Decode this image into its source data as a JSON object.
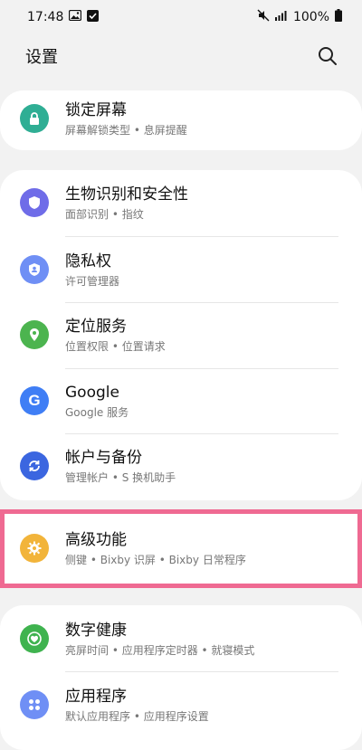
{
  "status_bar": {
    "time": "17:48",
    "battery": "100%"
  },
  "header": {
    "title": "设置"
  },
  "items": [
    {
      "title": "锁定屏幕",
      "subtitle": "屏幕解锁类型 • 息屏提醒",
      "color": "#2fae94"
    },
    {
      "title": "生物识别和安全性",
      "subtitle": "面部识别 • 指纹",
      "color": "#6f6ce8"
    },
    {
      "title": "隐私权",
      "subtitle": "许可管理器",
      "color": "#6f8ff5"
    },
    {
      "title": "定位服务",
      "subtitle": "位置权限 • 位置请求",
      "color": "#4cb44f"
    },
    {
      "title": "Google",
      "subtitle": "Google 服务",
      "color": "#3f7ef5"
    },
    {
      "title": "帐户与备份",
      "subtitle": "管理帐户 • S 换机助手",
      "color": "#3b66e0"
    },
    {
      "title": "高级功能",
      "subtitle": "侧键 • Bixby 识屏 • Bixby 日常程序",
      "color": "#f2b43a"
    },
    {
      "title": "数字健康",
      "subtitle": "亮屏时间 • 应用程序定时器 • 就寝模式",
      "color": "#3fb34f"
    },
    {
      "title": "应用程序",
      "subtitle": "默认应用程序 • 应用程序设置",
      "color": "#6f8ff5"
    }
  ],
  "highlight_color": "#ef6a92"
}
